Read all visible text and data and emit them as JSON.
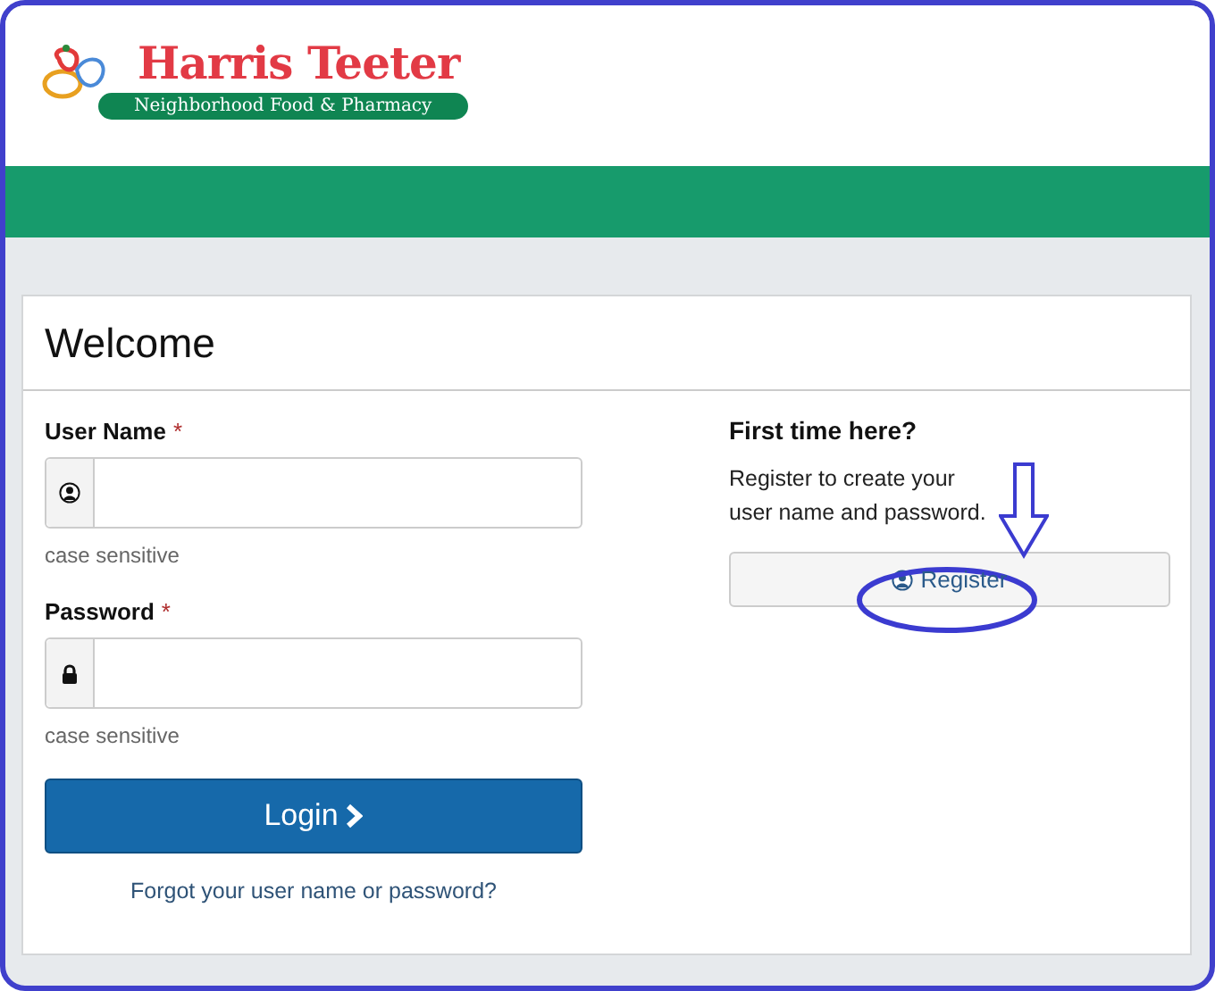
{
  "logo": {
    "name": "Harris Teeter",
    "tagline": "Neighborhood Food & Pharmacy"
  },
  "card": {
    "title": "Welcome"
  },
  "fields": [
    {
      "kind": "user",
      "label": "User Name",
      "required_mark": "*",
      "hint": "case sensitive"
    },
    {
      "kind": "password",
      "label": "Password",
      "required_mark": "*",
      "hint": "case sensitive"
    }
  ],
  "login_button": {
    "label": "Login"
  },
  "forgot_link": "Forgot your user name or password?",
  "register": {
    "heading": "First time here?",
    "text": "Register to create your\nuser name and password.",
    "button": "Register"
  }
}
